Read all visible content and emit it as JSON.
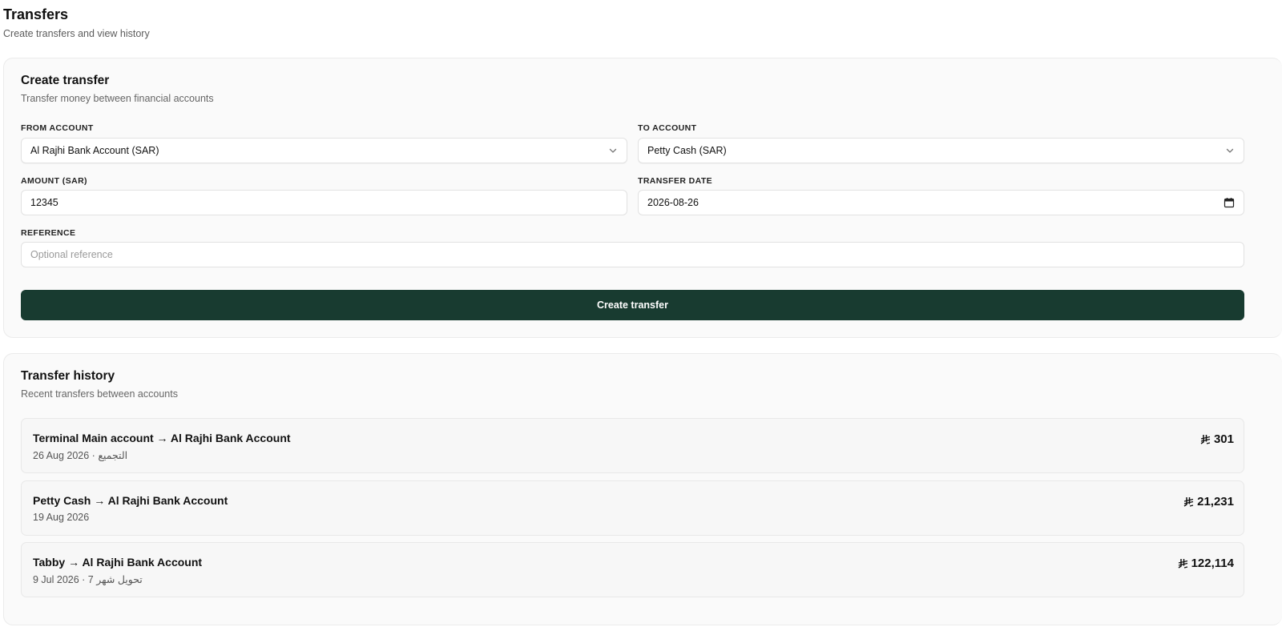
{
  "header": {
    "title": "Transfers",
    "subtitle": "Create transfers and view history"
  },
  "create_card": {
    "title": "Create transfer",
    "subtitle": "Transfer money between financial accounts",
    "from_label": "FROM ACCOUNT",
    "from_value": "Al Rajhi Bank Account (SAR)",
    "to_label": "TO ACCOUNT",
    "to_value": "Petty Cash (SAR)",
    "amount_label": "AMOUNT (SAR)",
    "amount_value": "12345",
    "date_label": "TRANSFER DATE",
    "date_value": "2026-08-26",
    "reference_label": "REFERENCE",
    "reference_placeholder": "Optional reference",
    "submit_label": "Create transfer"
  },
  "history": {
    "title": "Transfer history",
    "subtitle": "Recent transfers between accounts",
    "items": [
      {
        "title": "Terminal Main account → Al Rajhi Bank Account",
        "meta": "26 Aug 2026 · التجميع",
        "amount": "301"
      },
      {
        "title": "Petty Cash → Al Rajhi Bank Account",
        "meta": "19 Aug 2026",
        "amount": "21,231"
      },
      {
        "title": "Tabby → Al Rajhi Bank Account",
        "meta": "9 Jul 2026 · تحويل شهر 7",
        "amount": "122,114"
      }
    ]
  },
  "colors": {
    "primary_button": "#183b30",
    "card_background": "#fafafa"
  },
  "icons": {
    "select_chevron": "chevron-down-icon",
    "date_picker": "calendar-icon",
    "currency": "saudi-riyal-icon"
  }
}
